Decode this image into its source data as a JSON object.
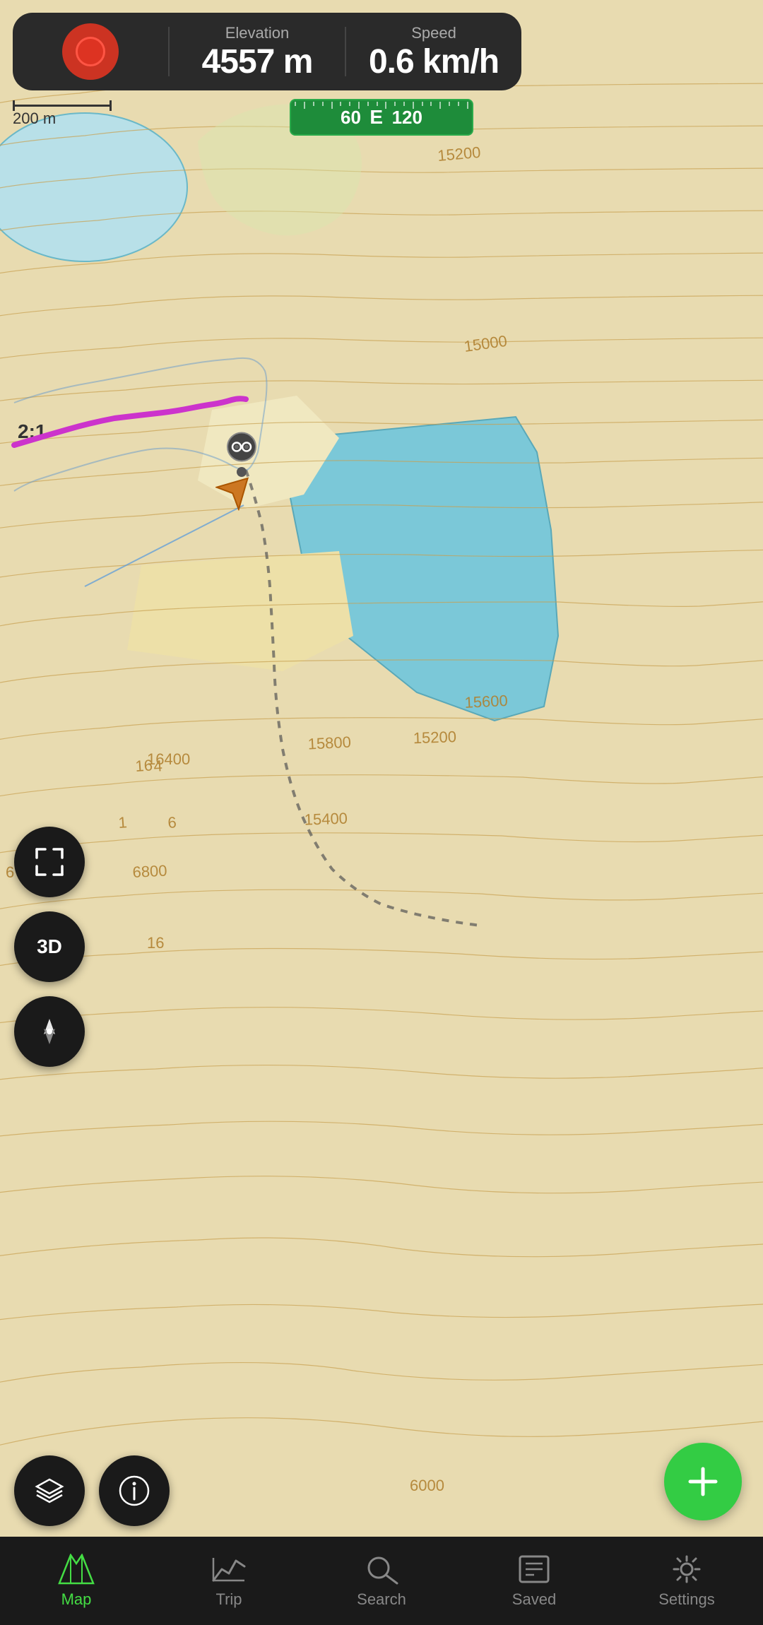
{
  "stats_bar": {
    "elevation_label": "Elevation",
    "elevation_value": "4557 m",
    "speed_label": "Speed",
    "speed_value": "0.6 km/h"
  },
  "scale": {
    "distance": "200 m"
  },
  "compass": {
    "left_num": "60",
    "direction": "E",
    "right_num": "120"
  },
  "buttons": {
    "expand_icon": "⤢",
    "btn_3d_label": "3D",
    "compass_icon": "◁",
    "layers_icon": "⊞",
    "info_icon": "ⓘ",
    "add_icon": "+"
  },
  "nav": {
    "items": [
      {
        "id": "map",
        "label": "Map",
        "active": true
      },
      {
        "id": "trip",
        "label": "Trip",
        "active": false
      },
      {
        "id": "search",
        "label": "Search",
        "active": false
      },
      {
        "id": "saved",
        "label": "Saved",
        "active": false
      },
      {
        "id": "settings",
        "label": "Settings",
        "active": false
      }
    ]
  }
}
